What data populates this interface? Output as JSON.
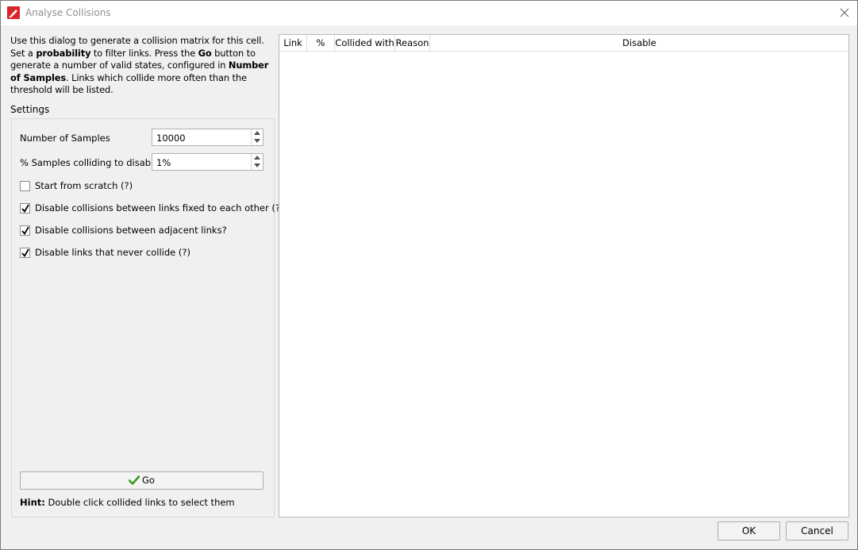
{
  "window": {
    "title": "Analyse Collisions"
  },
  "description": {
    "part1": "Use this dialog to generate a collision matrix for this cell. Set a ",
    "bold1": "probability",
    "part2": " to filter links. Press the ",
    "bold2": "Go",
    "part3": " button to generate a number of valid states, configured in ",
    "bold3": "Number of Samples",
    "part4": ". Links which collide more often than the threshold will be listed."
  },
  "settings": {
    "label": "Settings",
    "samples_label": "Number of Samples",
    "samples_value": "10000",
    "percent_label": "% Samples colliding to disable",
    "percent_value": "1%",
    "checkboxes": [
      {
        "label": "Start from scratch (?)",
        "checked": false
      },
      {
        "label": "Disable collisions between links fixed to each other (?)",
        "checked": true
      },
      {
        "label": "Disable collisions between adjacent links?",
        "checked": true
      },
      {
        "label": "Disable links that never collide (?)",
        "checked": true
      }
    ],
    "go_label": "Go",
    "hint_bold": "Hint:",
    "hint_text": " Double click collided links to select them"
  },
  "table": {
    "columns": [
      "Link",
      "%",
      "Collided with",
      "Reason",
      "Disable"
    ]
  },
  "buttons": {
    "ok": "OK",
    "cancel": "Cancel"
  },
  "colors": {
    "app_icon": "#d9262b",
    "check_green": "#3a9a1c"
  }
}
